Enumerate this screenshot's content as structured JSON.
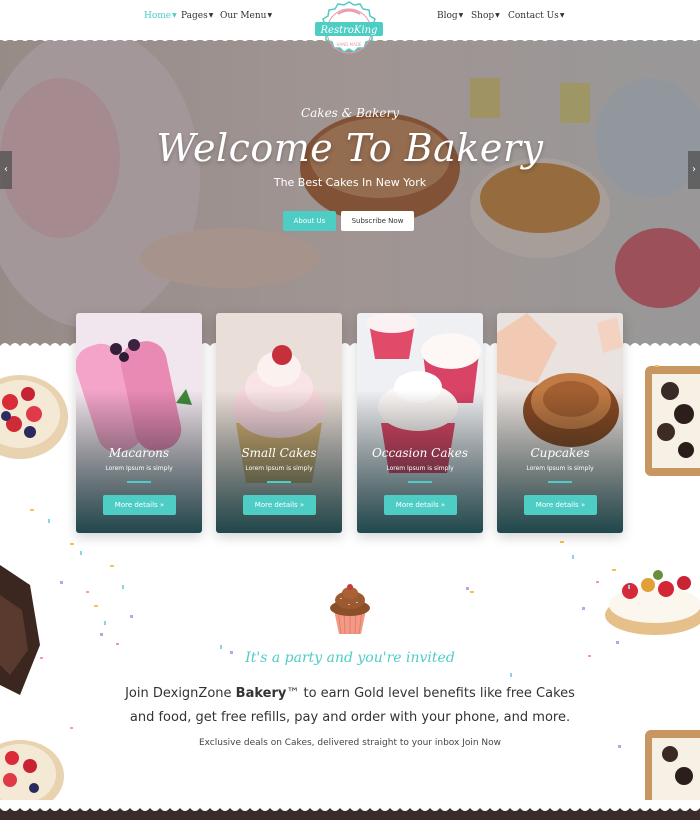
{
  "nav": {
    "left": [
      {
        "label": "Home",
        "active": true
      },
      {
        "label": "Pages",
        "active": false
      },
      {
        "label": "Our Menu",
        "active": false
      }
    ],
    "right": [
      {
        "label": "Blog",
        "active": false
      },
      {
        "label": "Shop",
        "active": false
      },
      {
        "label": "Contact Us",
        "active": false
      }
    ],
    "logo": {
      "name": "RestroKing",
      "tagline": "HAND MADE"
    }
  },
  "hero": {
    "subtitle": "Cakes & Bakery",
    "title": "Welcome To Bakery",
    "tagline": "The Best Cakes In New York",
    "btn_about": "About Us",
    "btn_subscribe": "Subscribe Now",
    "prev_icon": "chevron-left-icon",
    "next_icon": "chevron-right-icon"
  },
  "cards": [
    {
      "title": "Macarons",
      "subtitle": "Lorem Ipsum is simply",
      "button": "More details »"
    },
    {
      "title": "Small Cakes",
      "subtitle": "Lorem Ipsum is simply",
      "button": "More details »"
    },
    {
      "title": "Occasion Cakes",
      "subtitle": "Lorem Ipsum is simply",
      "button": "More details »"
    },
    {
      "title": "Cupcakes",
      "subtitle": "Lorem Ipsum is simply",
      "button": "More details »"
    }
  ],
  "invite": {
    "heading": "It's a party and you're invited",
    "desc_before": "Join DexignZone ",
    "desc_bold": "Bakery",
    "desc_after": "™ to earn Gold level benefits like free Cakes and food, get free refills, pay and order with your phone, and more.",
    "exclusive": "Exclusive deals on Cakes, delivered straight to your inbox Join Now"
  },
  "colors": {
    "accent": "#4ecdc4",
    "dark_text": "#333333"
  }
}
